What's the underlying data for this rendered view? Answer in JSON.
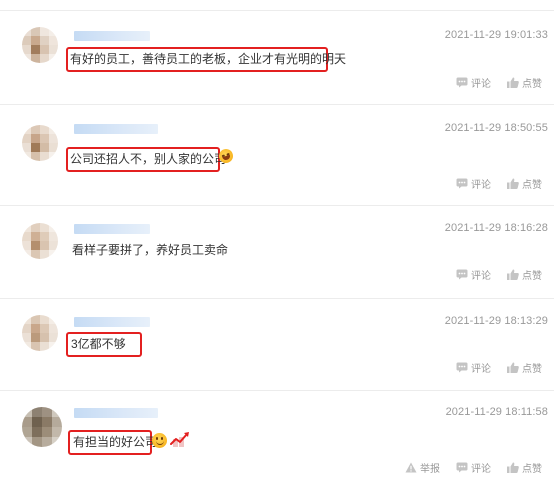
{
  "comments": [
    {
      "timestamp": "2021-11-29 19:01:33",
      "text": "有好的员工，善待员工的老板，企业才有光明的明天",
      "actions": {
        "comment": "评论",
        "like": "点赞"
      }
    },
    {
      "timestamp": "2021-11-29 18:50:55",
      "text": "公司还招人不，别人家的公司",
      "actions": {
        "comment": "评论",
        "like": "点赞"
      }
    },
    {
      "timestamp": "2021-11-29 18:16:28",
      "text": "看样子要拼了，养好员工卖命",
      "actions": {
        "comment": "评论",
        "like": "点赞"
      }
    },
    {
      "timestamp": "2021-11-29 18:13:29",
      "text": "3亿都不够",
      "actions": {
        "comment": "评论",
        "like": "点赞"
      }
    },
    {
      "timestamp": "2021-11-29 18:11:58",
      "text": "有担当的好公司",
      "actions": {
        "report": "举报",
        "comment": "评论",
        "like": "点赞"
      }
    }
  ],
  "colors": {
    "highlight": "#e32020",
    "meta_text": "#999999",
    "name_blur": "#c5dbf4",
    "divider": "#ececec"
  },
  "icons": [
    "comment-icon",
    "like-icon",
    "report-icon",
    "laughing-emoji-icon",
    "smile-emoji-icon",
    "rising-chart-emoji-icon"
  ]
}
